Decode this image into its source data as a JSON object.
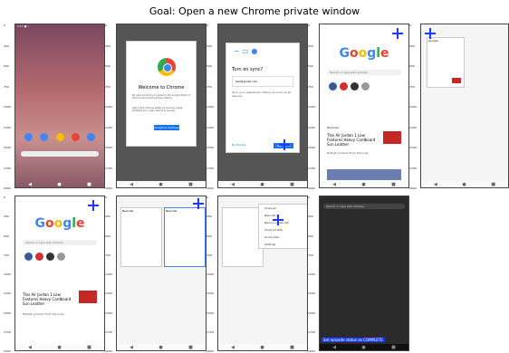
{
  "title": "Goal: Open a new Chrome private window",
  "axis_ticks_y": [
    "0",
    "250",
    "500",
    "750",
    "1000",
    "1250",
    "1500",
    "1750",
    "2000"
  ],
  "axis_ticks_x": [
    "0",
    "250",
    "500",
    "750",
    "1000"
  ],
  "frames": [
    {
      "id": "home",
      "status": "1:17 ● •"
    },
    {
      "id": "welcome",
      "heading": "Welcome to Chrome",
      "terms": "By using Chrome you agree to the Google Terms of Service and Chrome Privacy Notice",
      "checkbox": "Help make Chrome better by sending usage statistics and crash reports to Google",
      "button": "Accept & continue"
    },
    {
      "id": "sync",
      "heading": "Turn on sync?",
      "account": "test@gmail.com",
      "desc": "Sync your passwords, history & more on all devices",
      "no": "No thanks",
      "yes": "Yes, I'm in"
    },
    {
      "id": "newtab",
      "search": "Search or type web address",
      "discover": "Discover",
      "article": "This Air Jordan 1 Low Features Heavy Cardboard Sun Leather",
      "sub": "Refresh Jordans From Discover"
    },
    {
      "id": "switcher",
      "label": "Google"
    },
    {
      "id": "newtab2",
      "search": "Search or type web address",
      "article": "This Air Jordan 1 Low Features Heavy Cardboard Sun Leather",
      "sub": "Refresh Jordans From Discover"
    },
    {
      "id": "tabs",
      "label": "New tab"
    },
    {
      "id": "menu",
      "items": [
        "Close all",
        "New tab",
        "New incognito tab",
        "Close all tabs",
        "Group tabs",
        "Settings"
      ]
    },
    {
      "id": "incognito",
      "search": "Search or type web address",
      "status_label": "Set episode status as COMPLETE"
    }
  ]
}
